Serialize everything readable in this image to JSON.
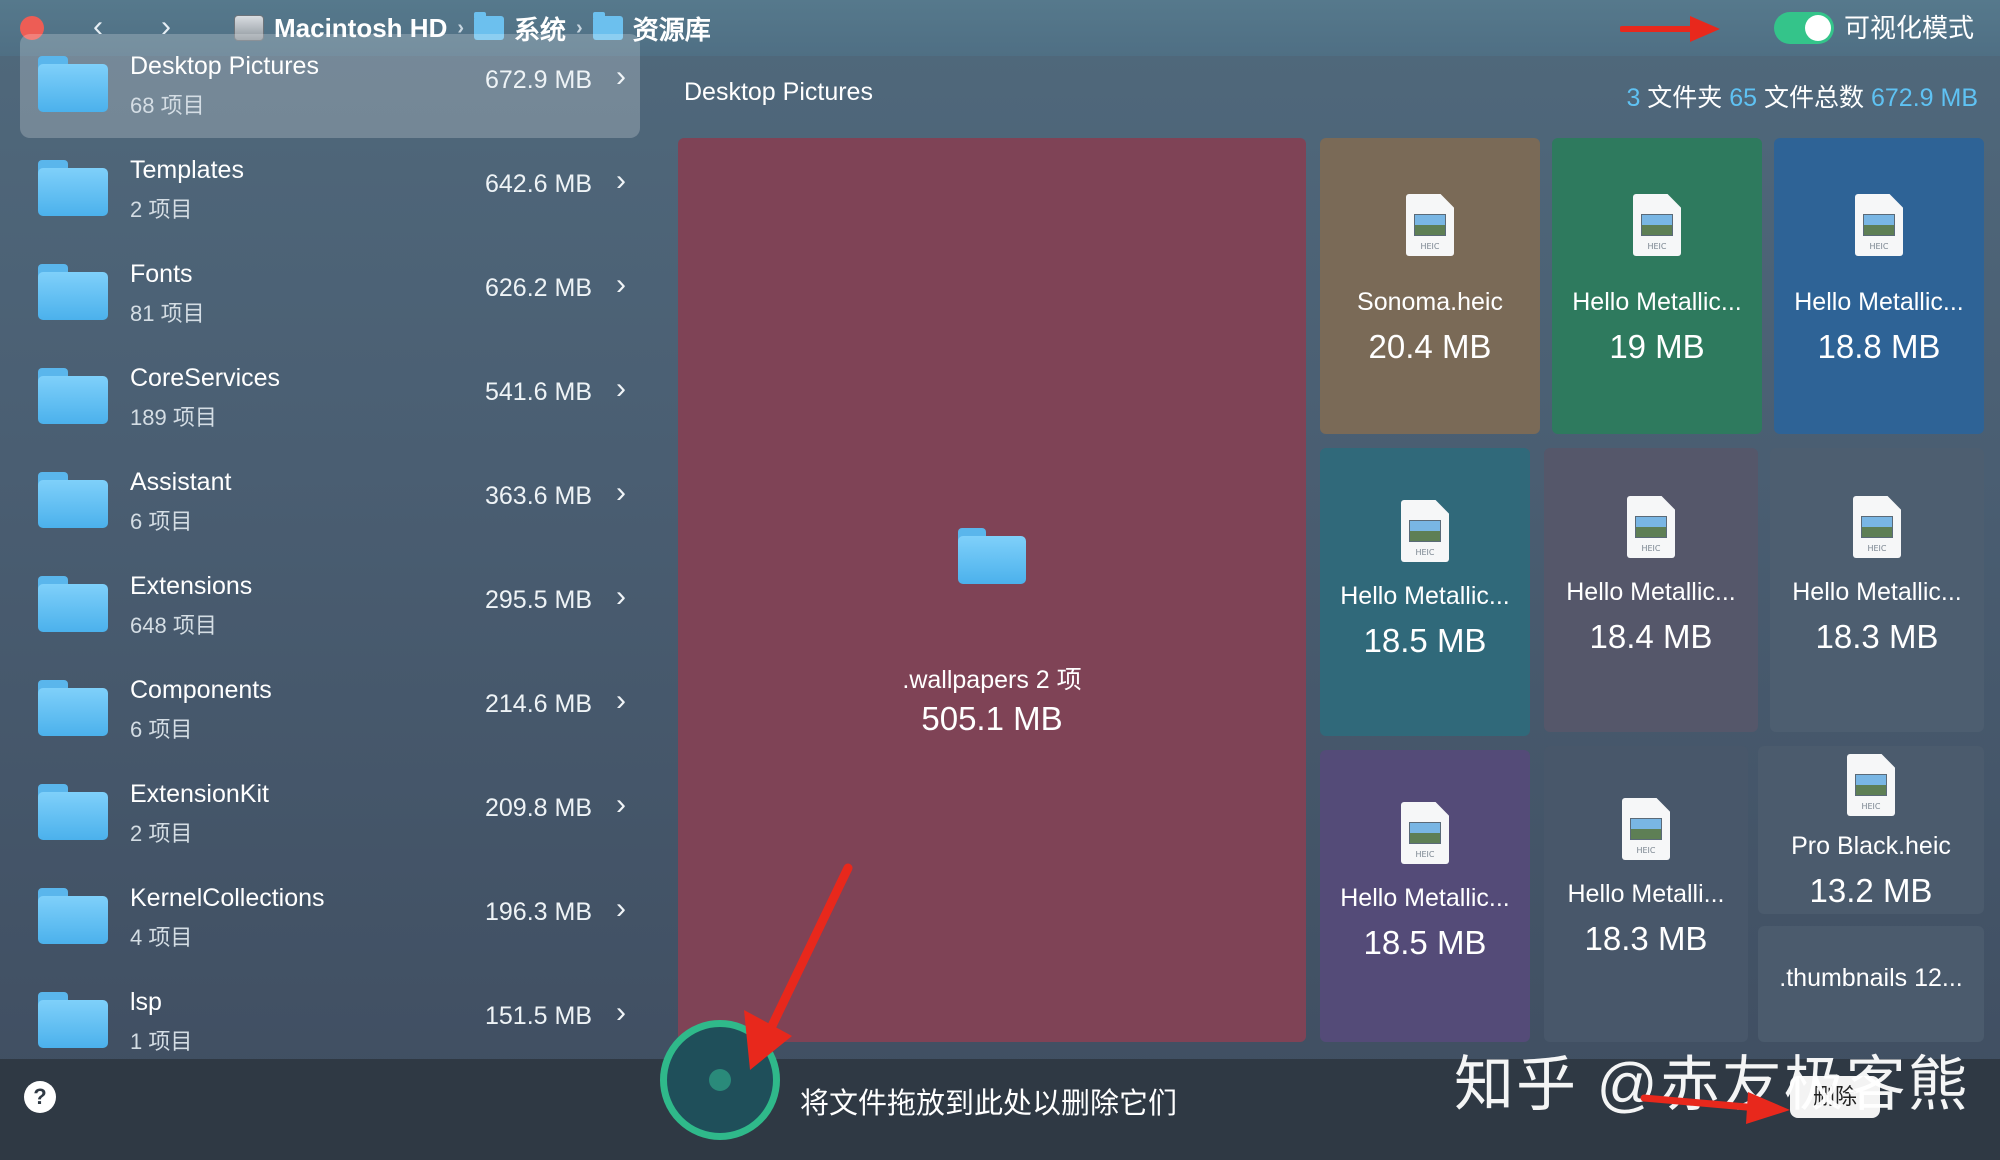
{
  "titlebar": {
    "back_icon": "‹",
    "forward_icon": "›",
    "crumbs": [
      {
        "label": "Macintosh HD",
        "icon": "hard-drive-icon"
      },
      {
        "label": "系统",
        "icon": "folder-icon"
      },
      {
        "label": "资源库",
        "icon": "folder-icon"
      }
    ],
    "separator": "›",
    "visual_mode_label": "可视化模式",
    "visual_mode_on": true
  },
  "sidebar": {
    "items": [
      {
        "name": "Desktop Pictures",
        "count": "68 项目",
        "size": "672.9 MB",
        "selected": true
      },
      {
        "name": "Templates",
        "count": "2 项目",
        "size": "642.6 MB"
      },
      {
        "name": "Fonts",
        "count": "81 项目",
        "size": "626.2 MB"
      },
      {
        "name": "CoreServices",
        "count": "189 项目",
        "size": "541.6 MB"
      },
      {
        "name": "Assistant",
        "count": "6 项目",
        "size": "363.6 MB"
      },
      {
        "name": "Extensions",
        "count": "648 项目",
        "size": "295.5 MB"
      },
      {
        "name": "Components",
        "count": "6 项目",
        "size": "214.6 MB"
      },
      {
        "name": "ExtensionKit",
        "count": "2 项目",
        "size": "209.8 MB"
      },
      {
        "name": "KernelCollections",
        "count": "4 项目",
        "size": "196.3 MB"
      },
      {
        "name": "lsp",
        "count": "1 项目",
        "size": "151.5 MB"
      }
    ],
    "chevron": "›"
  },
  "main": {
    "title": "Desktop Pictures",
    "stats": {
      "folders": "3",
      "folders_label": " 文件夹 ",
      "files": "65",
      "files_label": " 文件总数 ",
      "total": "672.9 MB"
    },
    "tiles": [
      {
        "name": ".wallpapers 2 项",
        "size": "505.1 MB",
        "kind": "folder",
        "color": "#7f4356"
      },
      {
        "name": "Sonoma.heic",
        "size": "20.4 MB",
        "kind": "heic",
        "color": "#7a6a57"
      },
      {
        "name": "Hello Metallic...",
        "size": "19 MB",
        "kind": "heic",
        "color": "#2e7a5e"
      },
      {
        "name": "Hello Metallic...",
        "size": "18.8 MB",
        "kind": "heic",
        "color": "#2e6396"
      },
      {
        "name": "Hello Metallic...",
        "size": "18.5 MB",
        "kind": "heic",
        "color": "#30697a"
      },
      {
        "name": "Hello Metallic...",
        "size": "18.4 MB",
        "kind": "heic",
        "color": "#55576a"
      },
      {
        "name": "Hello Metallic...",
        "size": "18.3 MB",
        "kind": "heic",
        "color": "#4d5e70"
      },
      {
        "name": "Hello Metallic...",
        "size": "18.5 MB",
        "kind": "heic",
        "color": "#544b78"
      },
      {
        "name": "Hello Metalli...",
        "size": "18.3 MB",
        "kind": "heic",
        "color": "#48576a"
      },
      {
        "name": "Pro Black.heic",
        "size": "13.2 MB",
        "kind": "heic",
        "color": "#4b5b6d"
      },
      {
        "name": ".thumbnails 12...",
        "size": "",
        "kind": "text",
        "color": "#4b5b6d"
      }
    ],
    "heic_label": "HEIC"
  },
  "bottom": {
    "help": "?",
    "drop_text": "将文件拖放到此处以删除它们",
    "delete_label": "删除",
    "watermark": "知乎 @赤友极客熊"
  },
  "colors": {
    "accent": "#34c48a",
    "stat_highlight": "#5fc2f3",
    "annotation_arrow": "#e8281c"
  }
}
